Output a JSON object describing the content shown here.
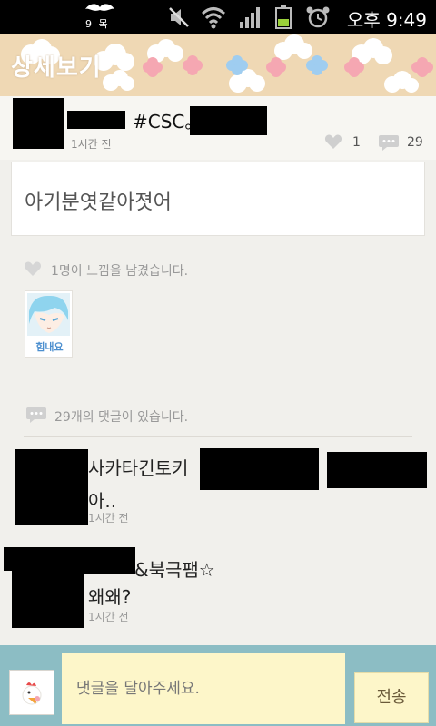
{
  "status_bar": {
    "indicator_text": "9 목",
    "clock": "오후 9:49",
    "icons": [
      "mustache-icon",
      "mute-icon",
      "wifi-icon",
      "signal-icon",
      "battery-icon",
      "alarm-icon"
    ]
  },
  "header": {
    "title": "상세보기"
  },
  "post": {
    "tag": "#CSC。",
    "time": "1시간 전",
    "like_count": "1",
    "comment_count": "29",
    "content": "아기분엿같아졋어"
  },
  "feelings": {
    "summary": "1명이 느낌을 남겼습니다.",
    "sticker_label": "힘내요"
  },
  "comments_header": {
    "text": "29개의 댓글이 있습니다."
  },
  "comments": [
    {
      "name_visible": "사카타긴토키",
      "text": "아..",
      "time": "1시간 전"
    },
    {
      "name_visible": "&북극팸☆",
      "text": "왜왜?",
      "time": "1시간 전"
    }
  ],
  "input_bar": {
    "placeholder": "댓글을 달아주세요.",
    "send_label": "전송"
  },
  "colors": {
    "title_bar": "#efd8b4",
    "input_bar": "#8cbdc4",
    "input_field": "#fdf6c9",
    "page_bg": "#f1f0ec"
  }
}
